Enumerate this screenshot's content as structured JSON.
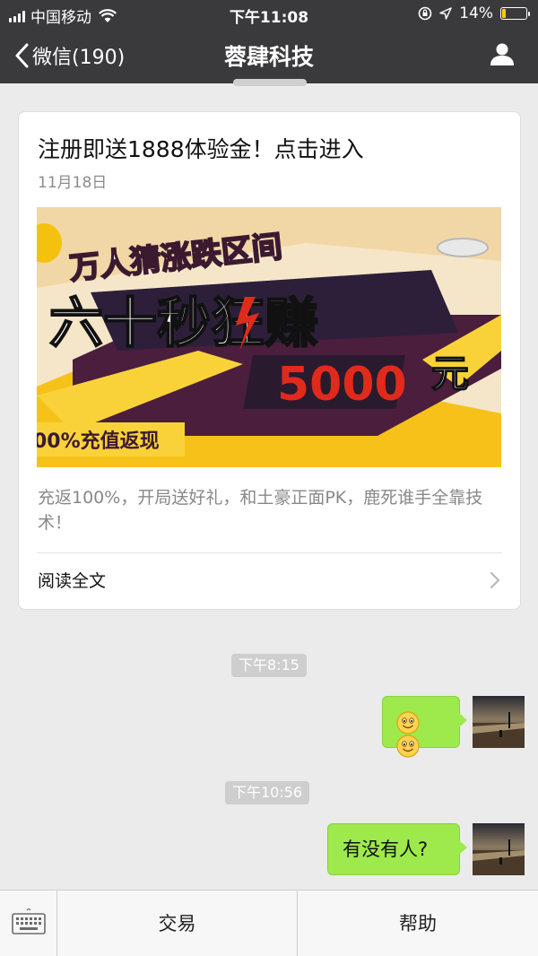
{
  "status_bar": {
    "carrier": "中国移动",
    "time": "下午11:08",
    "battery_text": "14%",
    "battery_level": 0.14,
    "icons": [
      "signal-icon",
      "wifi-icon",
      "lock-rotation-icon",
      "location-icon",
      "battery-icon"
    ]
  },
  "nav": {
    "back_label": "微信(190)",
    "title": "蓉肆科技",
    "icons": [
      "back-chevron-icon",
      "profile-icon"
    ]
  },
  "article": {
    "title": "注册即送1888体验金！点击进入",
    "date": "11月18日",
    "banner": {
      "line1": "万人猜涨跌区间",
      "line2": "六十秒狂赚",
      "amount": "5000",
      "unit": "元",
      "badge": "00%充值返现"
    },
    "description": "充返100%，开局送好礼，和土豪正面PK，鹿死谁手全靠技术！",
    "read_more": "阅读全文"
  },
  "messages": [
    {
      "timestamp": "下午8:15",
      "kind": "emoji",
      "emojis": [
        "smile-emoji",
        "smile-emoji"
      ],
      "sender": "me"
    },
    {
      "timestamp": "下午10:56",
      "kind": "text",
      "text": "有没有人?",
      "sender": "me"
    }
  ],
  "bottom_menu": {
    "items": [
      "交易",
      "帮助"
    ],
    "icons": [
      "keyboard-icon"
    ]
  },
  "colors": {
    "nav_bg": "#3a3a3c",
    "chat_bg": "#ebebeb",
    "bubble_green": "#9ee94c",
    "battery_yellow": "#ffcc00",
    "banner_yellow": "#f6c21a",
    "banner_red": "#e02a1c"
  }
}
